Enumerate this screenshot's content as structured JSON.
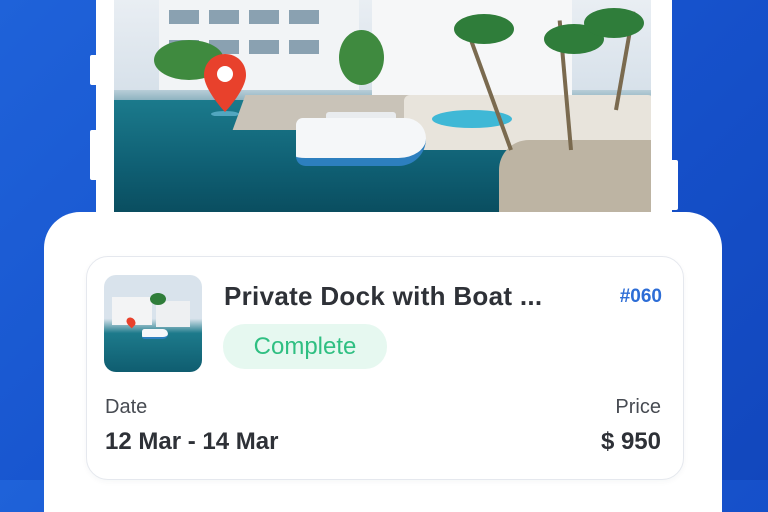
{
  "listing": {
    "title": "Private Dock with Boat ...",
    "booking_id": "#060",
    "status": "Complete",
    "status_color": "#2fbf82",
    "status_bg": "#e6f8f0"
  },
  "details": {
    "date_label": "Date",
    "date_value": "12 Mar - 14 Mar",
    "price_label": "Price",
    "price_value": "$ 950"
  },
  "icons": {
    "map_pin": "map-pin-icon"
  },
  "colors": {
    "background": "#1652cc",
    "accent": "#2d6dd6",
    "pin": "#e8412c"
  }
}
